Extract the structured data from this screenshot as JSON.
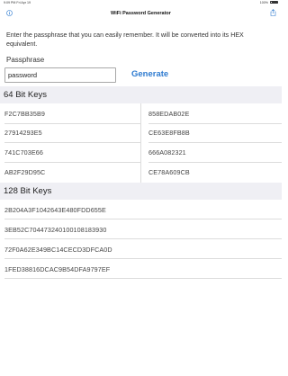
{
  "status_bar": {
    "time": "9:09 PM",
    "date": "Fri Apr 19",
    "battery": "100%"
  },
  "nav": {
    "title": "WiFi Password Generator"
  },
  "intro_text": "Enter the passphrase that you can easily remember. It will be converted into its HEX equivalent.",
  "passphrase": {
    "label": "Passphrase",
    "value": "password",
    "placeholder": ""
  },
  "generate_label": "Generate",
  "keys64": {
    "header": "64 Bit Keys",
    "items": [
      "F2C7BB35B9",
      "858EDAB02E",
      "27914293E5",
      "CE63E8FB8B",
      "741C703E66",
      "666A082321",
      "AB2F29D95C",
      "CE78A609CB"
    ]
  },
  "keys128": {
    "header": "128 Bit Keys",
    "items": [
      "2B204A3F1042643E480FDD655E",
      "3EB52C704473240100108183930",
      "72F0A62E349BC14CECD3DFCA0D",
      "1FED38816DCAC9B54DFA9797EF"
    ]
  },
  "colors": {
    "accent": "#2e7bd0",
    "section_bg": "#efeff4"
  }
}
